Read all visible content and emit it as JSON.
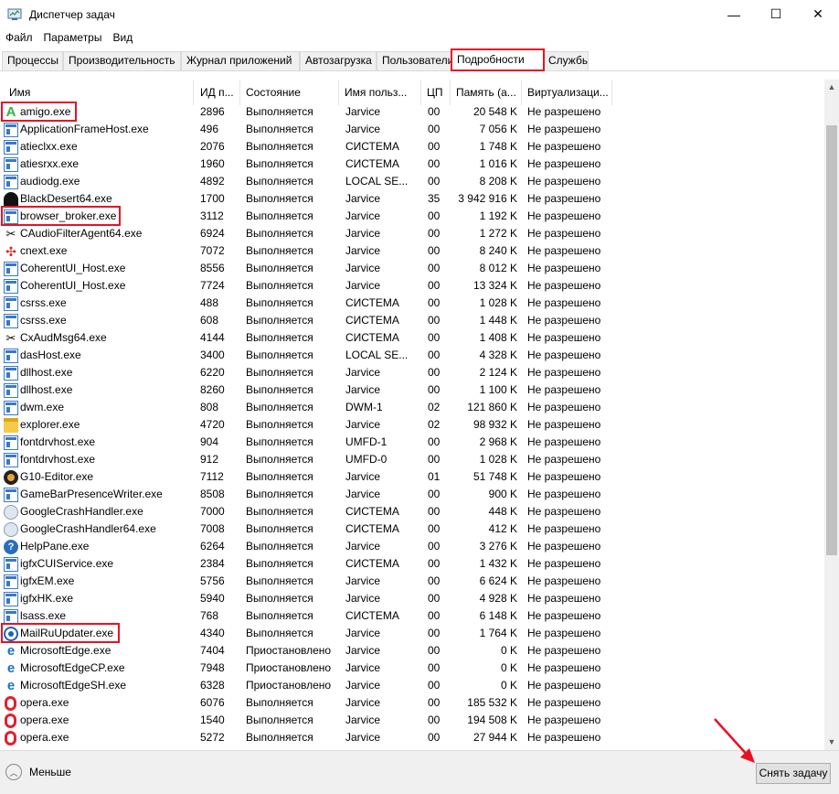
{
  "window": {
    "title": "Диспетчер задач",
    "controls": {
      "minimize": "—",
      "maximize": "☐",
      "close": "✕"
    }
  },
  "menu": [
    "Файл",
    "Параметры",
    "Вид"
  ],
  "tabs": [
    {
      "label": "Процессы",
      "active": false
    },
    {
      "label": "Производительность",
      "active": false
    },
    {
      "label": "Журнал приложений",
      "active": false
    },
    {
      "label": "Автозагрузка",
      "active": false
    },
    {
      "label": "Пользователи",
      "active": false
    },
    {
      "label": "Подробности",
      "active": true
    },
    {
      "label": "Службы",
      "active": false
    }
  ],
  "columns": {
    "name": "Имя",
    "pid": "ИД п...",
    "state": "Состояние",
    "user": "Имя польз...",
    "cpu": "ЦП",
    "mem": "Память (а...",
    "virt": "Виртуализаци..."
  },
  "rows": [
    {
      "icon": "amigo-icon",
      "name": "amigo.exe",
      "pid": "2896",
      "state": "Выполняется",
      "user": "Jarvice",
      "cpu": "00",
      "mem": "20 548 K",
      "virt": "Не разрешено",
      "highlighted": true
    },
    {
      "icon": "app-window-icon",
      "name": "ApplicationFrameHost.exe",
      "pid": "496",
      "state": "Выполняется",
      "user": "Jarvice",
      "cpu": "00",
      "mem": "7 056 K",
      "virt": "Не разрешено"
    },
    {
      "icon": "app-window-icon",
      "name": "atieclxx.exe",
      "pid": "2076",
      "state": "Выполняется",
      "user": "СИСТЕМА",
      "cpu": "00",
      "mem": "1 748 K",
      "virt": "Не разрешено"
    },
    {
      "icon": "app-window-icon",
      "name": "atiesrxx.exe",
      "pid": "1960",
      "state": "Выполняется",
      "user": "СИСТЕМА",
      "cpu": "00",
      "mem": "1 016 K",
      "virt": "Не разрешено"
    },
    {
      "icon": "app-window-icon",
      "name": "audiodg.exe",
      "pid": "4892",
      "state": "Выполняется",
      "user": "LOCAL SE...",
      "cpu": "00",
      "mem": "8 208 K",
      "virt": "Не разрешено"
    },
    {
      "icon": "blackdesert-icon",
      "name": "BlackDesert64.exe",
      "pid": "1700",
      "state": "Выполняется",
      "user": "Jarvice",
      "cpu": "35",
      "mem": "3 942 916 K",
      "virt": "Не разрешено"
    },
    {
      "icon": "app-window-icon",
      "name": "browser_broker.exe",
      "pid": "3112",
      "state": "Выполняется",
      "user": "Jarvice",
      "cpu": "00",
      "mem": "1 192 K",
      "virt": "Не разрешено",
      "highlighted": true
    },
    {
      "icon": "audio-filter-icon",
      "name": "CAudioFilterAgent64.exe",
      "pid": "6924",
      "state": "Выполняется",
      "user": "Jarvice",
      "cpu": "00",
      "mem": "1 272 K",
      "virt": "Не разрешено"
    },
    {
      "icon": "cnext-icon",
      "name": "cnext.exe",
      "pid": "7072",
      "state": "Выполняется",
      "user": "Jarvice",
      "cpu": "00",
      "mem": "8 240 K",
      "virt": "Не разрешено"
    },
    {
      "icon": "app-window-icon",
      "name": "CoherentUI_Host.exe",
      "pid": "8556",
      "state": "Выполняется",
      "user": "Jarvice",
      "cpu": "00",
      "mem": "8 012 K",
      "virt": "Не разрешено"
    },
    {
      "icon": "app-window-icon",
      "name": "CoherentUI_Host.exe",
      "pid": "7724",
      "state": "Выполняется",
      "user": "Jarvice",
      "cpu": "00",
      "mem": "13 324 K",
      "virt": "Не разрешено"
    },
    {
      "icon": "app-window-icon",
      "name": "csrss.exe",
      "pid": "488",
      "state": "Выполняется",
      "user": "СИСТЕМА",
      "cpu": "00",
      "mem": "1 028 K",
      "virt": "Не разрешено"
    },
    {
      "icon": "app-window-icon",
      "name": "csrss.exe",
      "pid": "608",
      "state": "Выполняется",
      "user": "СИСТЕМА",
      "cpu": "00",
      "mem": "1 448 K",
      "virt": "Не разрешено"
    },
    {
      "icon": "audio-filter-icon",
      "name": "CxAudMsg64.exe",
      "pid": "4144",
      "state": "Выполняется",
      "user": "СИСТЕМА",
      "cpu": "00",
      "mem": "1 408 K",
      "virt": "Не разрешено"
    },
    {
      "icon": "app-window-icon",
      "name": "dasHost.exe",
      "pid": "3400",
      "state": "Выполняется",
      "user": "LOCAL SE...",
      "cpu": "00",
      "mem": "4 328 K",
      "virt": "Не разрешено"
    },
    {
      "icon": "app-window-icon",
      "name": "dllhost.exe",
      "pid": "6220",
      "state": "Выполняется",
      "user": "Jarvice",
      "cpu": "00",
      "mem": "2 124 K",
      "virt": "Не разрешено"
    },
    {
      "icon": "app-window-icon",
      "name": "dllhost.exe",
      "pid": "8260",
      "state": "Выполняется",
      "user": "Jarvice",
      "cpu": "00",
      "mem": "1 100 K",
      "virt": "Не разрешено"
    },
    {
      "icon": "app-window-icon",
      "name": "dwm.exe",
      "pid": "808",
      "state": "Выполняется",
      "user": "DWM-1",
      "cpu": "02",
      "mem": "121 860 K",
      "virt": "Не разрешено"
    },
    {
      "icon": "explorer-icon",
      "name": "explorer.exe",
      "pid": "4720",
      "state": "Выполняется",
      "user": "Jarvice",
      "cpu": "02",
      "mem": "98 932 K",
      "virt": "Не разрешено"
    },
    {
      "icon": "app-window-icon",
      "name": "fontdrvhost.exe",
      "pid": "904",
      "state": "Выполняется",
      "user": "UMFD-1",
      "cpu": "00",
      "mem": "2 968 K",
      "virt": "Не разрешено"
    },
    {
      "icon": "app-window-icon",
      "name": "fontdrvhost.exe",
      "pid": "912",
      "state": "Выполняется",
      "user": "UMFD-0",
      "cpu": "00",
      "mem": "1 028 K",
      "virt": "Не разрешено"
    },
    {
      "icon": "g10-icon",
      "name": "G10-Editor.exe",
      "pid": "7112",
      "state": "Выполняется",
      "user": "Jarvice",
      "cpu": "01",
      "mem": "51 748 K",
      "virt": "Не разрешено"
    },
    {
      "icon": "app-window-icon",
      "name": "GameBarPresenceWriter.exe",
      "pid": "8508",
      "state": "Выполняется",
      "user": "Jarvice",
      "cpu": "00",
      "mem": "900 K",
      "virt": "Не разрешено"
    },
    {
      "icon": "google-update-icon",
      "name": "GoogleCrashHandler.exe",
      "pid": "7000",
      "state": "Выполняется",
      "user": "СИСТЕМА",
      "cpu": "00",
      "mem": "448 K",
      "virt": "Не разрешено"
    },
    {
      "icon": "google-update-icon",
      "name": "GoogleCrashHandler64.exe",
      "pid": "7008",
      "state": "Выполняется",
      "user": "СИСТЕМА",
      "cpu": "00",
      "mem": "412 K",
      "virt": "Не разрешено"
    },
    {
      "icon": "help-icon",
      "name": "HelpPane.exe",
      "pid": "6264",
      "state": "Выполняется",
      "user": "Jarvice",
      "cpu": "00",
      "mem": "3 276 K",
      "virt": "Не разрешено"
    },
    {
      "icon": "app-window-icon",
      "name": "igfxCUIService.exe",
      "pid": "2384",
      "state": "Выполняется",
      "user": "СИСТЕМА",
      "cpu": "00",
      "mem": "1 432 K",
      "virt": "Не разрешено"
    },
    {
      "icon": "app-window-icon",
      "name": "igfxEM.exe",
      "pid": "5756",
      "state": "Выполняется",
      "user": "Jarvice",
      "cpu": "00",
      "mem": "6 624 K",
      "virt": "Не разрешено"
    },
    {
      "icon": "app-window-icon",
      "name": "igfxHK.exe",
      "pid": "5940",
      "state": "Выполняется",
      "user": "Jarvice",
      "cpu": "00",
      "mem": "4 928 K",
      "virt": "Не разрешено"
    },
    {
      "icon": "app-window-icon",
      "name": "lsass.exe",
      "pid": "768",
      "state": "Выполняется",
      "user": "СИСТЕМА",
      "cpu": "00",
      "mem": "6 148 K",
      "virt": "Не разрешено"
    },
    {
      "icon": "mailru-icon",
      "name": "MailRuUpdater.exe",
      "pid": "4340",
      "state": "Выполняется",
      "user": "Jarvice",
      "cpu": "00",
      "mem": "1 764 K",
      "virt": "Не разрешено",
      "highlighted": true
    },
    {
      "icon": "edge-icon",
      "name": "MicrosoftEdge.exe",
      "pid": "7404",
      "state": "Приостановлено",
      "user": "Jarvice",
      "cpu": "00",
      "mem": "0 K",
      "virt": "Не разрешено"
    },
    {
      "icon": "edge-icon",
      "name": "MicrosoftEdgeCP.exe",
      "pid": "7948",
      "state": "Приостановлено",
      "user": "Jarvice",
      "cpu": "00",
      "mem": "0 K",
      "virt": "Не разрешено"
    },
    {
      "icon": "edge-icon",
      "name": "MicrosoftEdgeSH.exe",
      "pid": "6328",
      "state": "Приостановлено",
      "user": "Jarvice",
      "cpu": "00",
      "mem": "0 K",
      "virt": "Не разрешено"
    },
    {
      "icon": "opera-icon",
      "name": "opera.exe",
      "pid": "6076",
      "state": "Выполняется",
      "user": "Jarvice",
      "cpu": "00",
      "mem": "185 532 K",
      "virt": "Не разрешено"
    },
    {
      "icon": "opera-icon",
      "name": "opera.exe",
      "pid": "1540",
      "state": "Выполняется",
      "user": "Jarvice",
      "cpu": "00",
      "mem": "194 508 K",
      "virt": "Не разрешено"
    },
    {
      "icon": "opera-icon",
      "name": "opera.exe",
      "pid": "5272",
      "state": "Выполняется",
      "user": "Jarvice",
      "cpu": "00",
      "mem": "27 944 K",
      "virt": "Не разрешено"
    }
  ],
  "footer": {
    "less_label": "Меньше",
    "end_task_label": "Снять задачу"
  },
  "colors": {
    "highlight": "#e81123",
    "arrow": "#e81123"
  }
}
